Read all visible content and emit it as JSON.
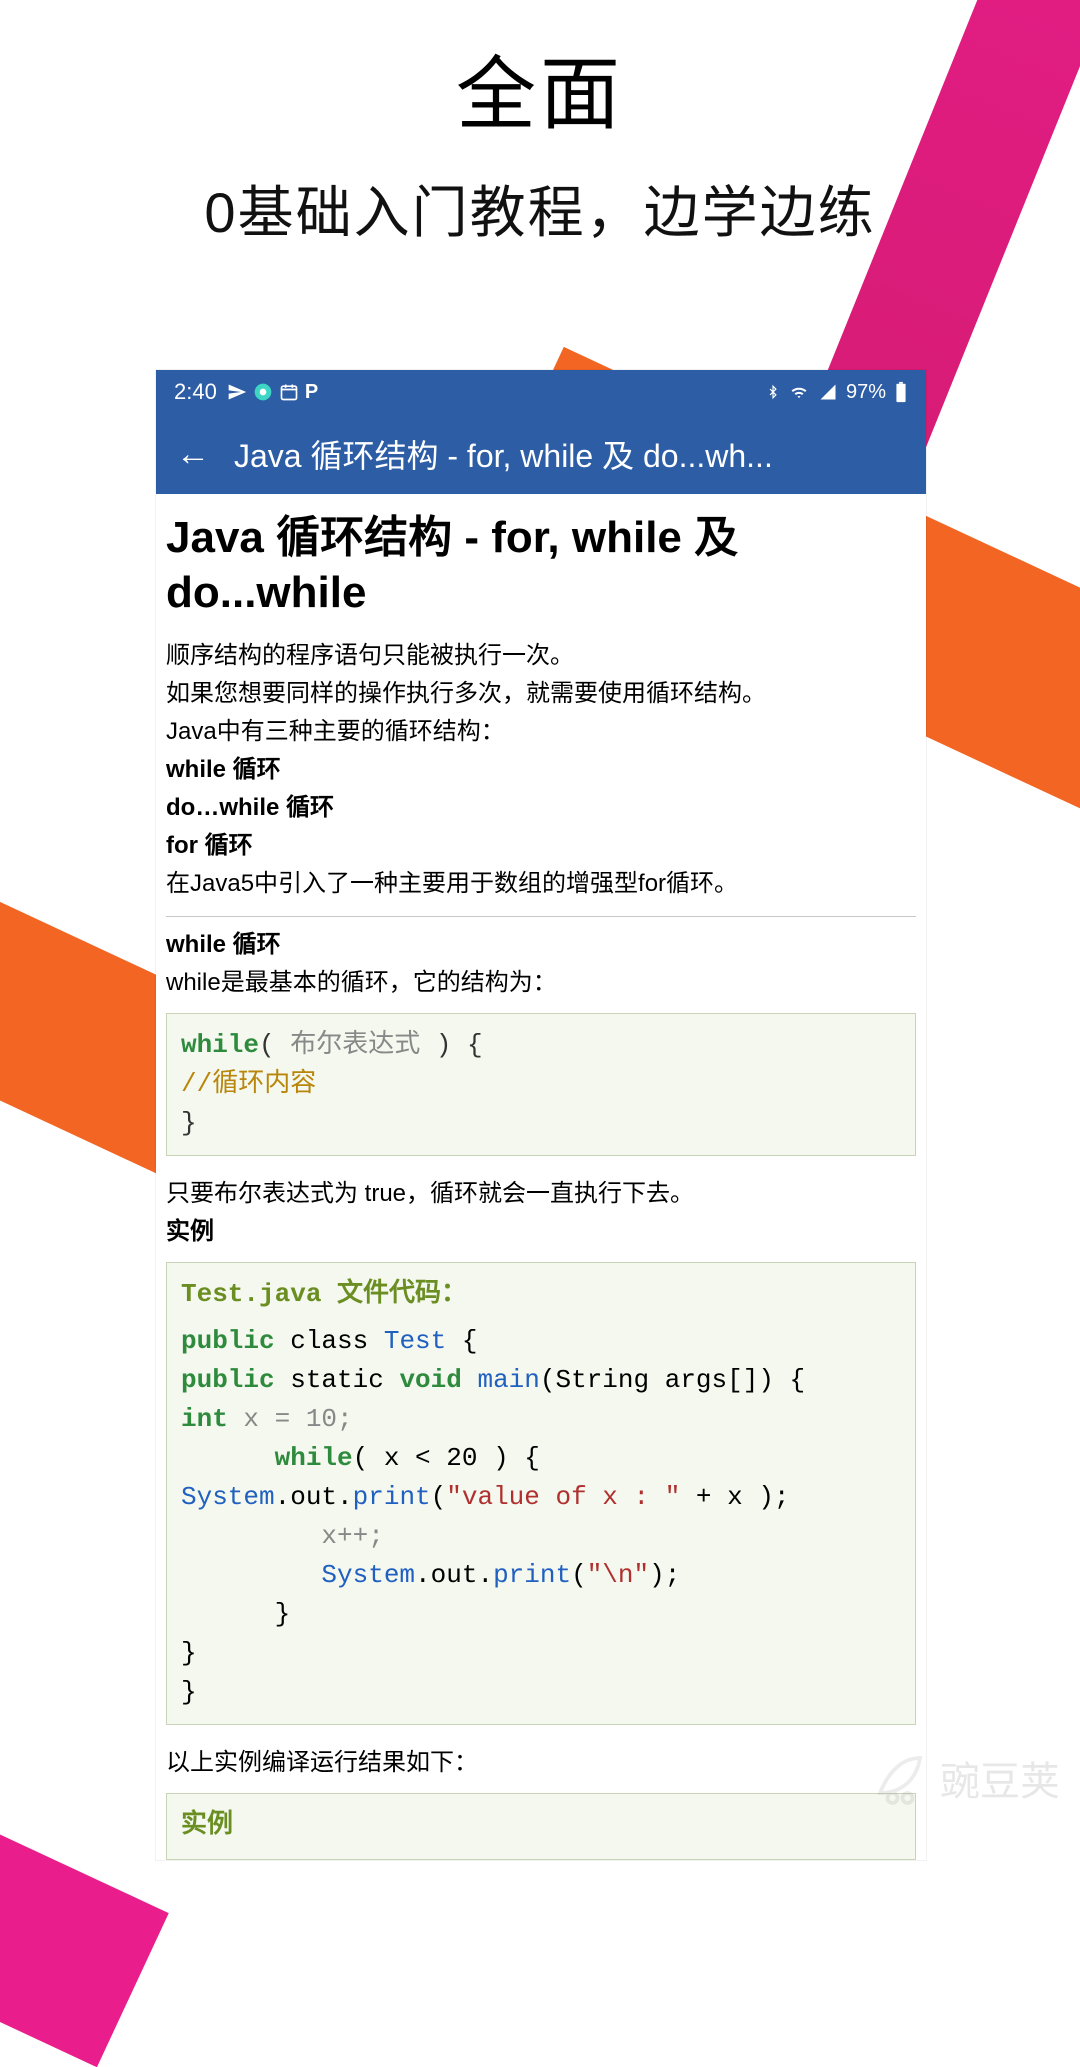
{
  "promo": {
    "title": "全面",
    "subtitle": "0基础入门教程，边学边练"
  },
  "status_bar": {
    "time": "2:40",
    "battery_text": "97%",
    "icons": {
      "send": "send-icon",
      "camera": "camera-icon",
      "calendar": "calendar-icon",
      "p": "p-icon",
      "bluetooth": "bluetooth-icon",
      "wifi": "wifi-icon",
      "signal": "signal-icon",
      "battery": "battery-icon"
    }
  },
  "app_bar": {
    "back": "←",
    "title": "Java 循环结构 - for, while 及 do...wh..."
  },
  "article": {
    "title": "Java 循环结构 - for, while 及 do...while",
    "p1": "顺序结构的程序语句只能被执行一次。",
    "p2": "如果您想要同样的操作执行多次，就需要使用循环结构。",
    "p3": "Java中有三种主要的循环结构：",
    "li1": "while 循环",
    "li2": "do…while 循环",
    "li3": "for 循环",
    "p4": "在Java5中引入了一种主要用于数组的增强型for循环。",
    "sec1_title": "while 循环",
    "sec1_desc": "while是最基本的循环，它的结构为：",
    "code1": {
      "kw_while": "while",
      "paren_open": "(",
      "expr": " 布尔表达式 ",
      "paren_close": ") {",
      "comment": "//循环内容",
      "close": "}"
    },
    "sec1_after": "只要布尔表达式为 true，循环就会一直执行下去。",
    "example_label": "实例",
    "code2_title": "Test.java 文件代码：",
    "code2": {
      "l1_public": "public",
      "l1_class": " class ",
      "l1_name": "Test",
      "l1_brace": " {",
      "l2_public": "public",
      "l2_static": " static ",
      "l2_void": "void ",
      "l2_main": "main",
      "l2_args": "(String args[]) {",
      "l3_int": "int",
      "l3_rest": " x = 10;",
      "l4_while": "      while",
      "l4_cond": "( x < 20 ) {",
      "l5_sys": "System",
      "l5_dot_out": ".out.",
      "l5_print": "print",
      "l5_open": "(",
      "l5_str": "\"value of x : \"",
      "l5_plus": " + x );",
      "l6": "         x++;",
      "l7_sys": "         System",
      "l7_dot_out": ".out.",
      "l7_print": "print",
      "l7_open": "(",
      "l7_str": "\"\\n\"",
      "l7_close": ");",
      "l8": "      }",
      "l9": "}",
      "l10": "}"
    },
    "result_text": "以上实例编译运行结果如下：",
    "example_label2": "实例"
  },
  "watermark": {
    "text": "豌豆荚"
  }
}
